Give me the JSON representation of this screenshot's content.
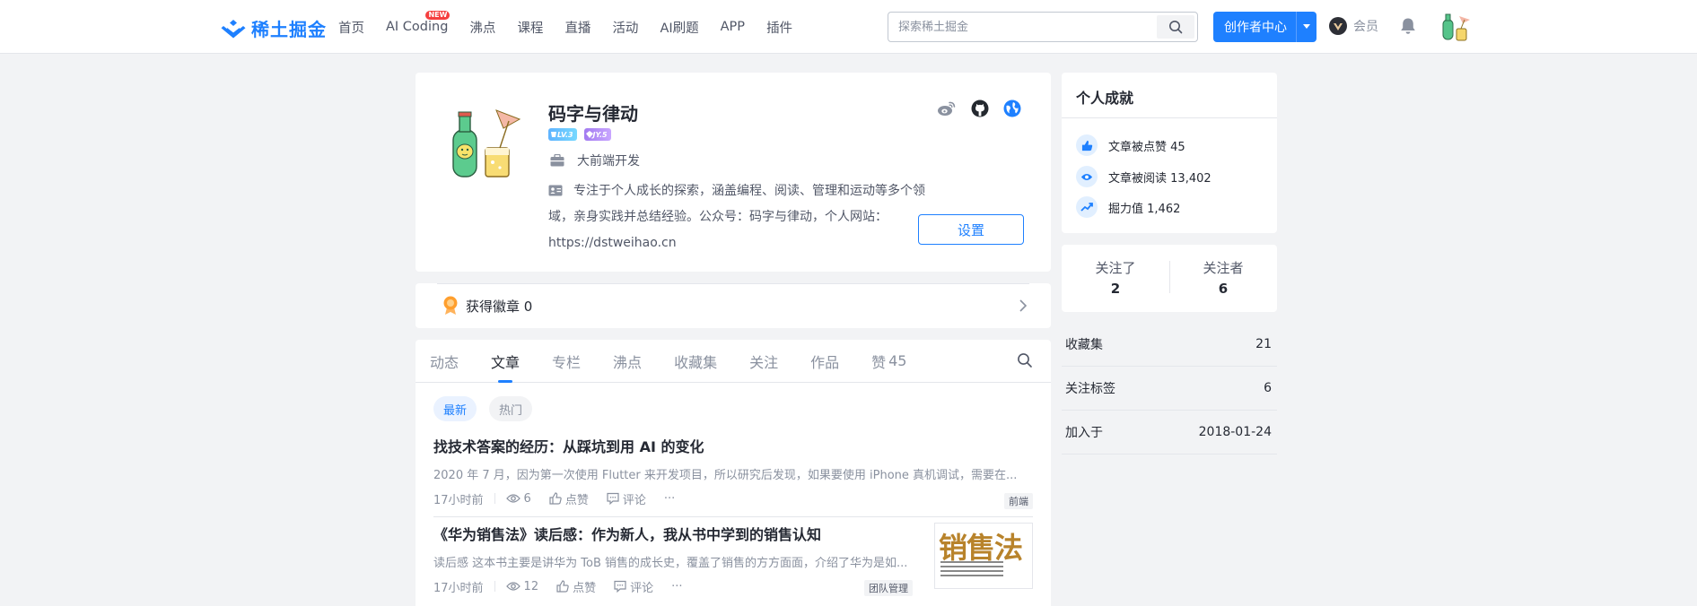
{
  "header": {
    "logo_text": "稀土掘金",
    "nav": [
      {
        "label": "首页"
      },
      {
        "label": "AI Coding",
        "badge": "NEW"
      },
      {
        "label": "沸点"
      },
      {
        "label": "课程"
      },
      {
        "label": "直播"
      },
      {
        "label": "活动"
      },
      {
        "label": "AI刷题"
      },
      {
        "label": "APP"
      },
      {
        "label": "插件"
      }
    ],
    "search_placeholder": "探索稀土掘金",
    "creator_label": "创作者中心",
    "vip_label": "会员"
  },
  "profile": {
    "username": "码字与律动",
    "level_badge": "LV.3",
    "jy_badge": "JY.5",
    "job": "大前端开发",
    "bio": "专注于个人成长的探索，涵盖编程、阅读、管理和运动等多个领域，亲身实践并总结经验。公众号：码字与律动，个人网站：https://dstweihao.cn",
    "settings_label": "设置"
  },
  "badges": {
    "label": "获得徽章 0"
  },
  "tabs": [
    {
      "label": "动态"
    },
    {
      "label": "文章",
      "active": true
    },
    {
      "label": "专栏"
    },
    {
      "label": "沸点"
    },
    {
      "label": "收藏集"
    },
    {
      "label": "关注"
    },
    {
      "label": "作品"
    },
    {
      "label": "赞",
      "count": "45"
    }
  ],
  "filters": {
    "latest": "最新",
    "hot": "热门"
  },
  "articles": [
    {
      "title": "找技术答案的经历：从踩坑到用 AI 的变化",
      "brief": "2020 年 7 月，因为第一次使用 Flutter 来开发项目，所以研究后发现，如果要使用 iPhone 真机调试，需要在...",
      "time": "17小时前",
      "views": "6",
      "like": "点赞",
      "comment": "评论",
      "more": "···",
      "tag": "前端"
    },
    {
      "title": "《华为销售法》读后感：作为新人，我从书中学到的销售认知",
      "brief": "读后感 这本书主要是讲华为 ToB 销售的成长史，覆盖了销售的方方面面，介绍了华为是如...",
      "time": "17小时前",
      "views": "12",
      "like": "点赞",
      "comment": "评论",
      "more": "···",
      "tag": "团队管理",
      "thumb_text": "销售法"
    }
  ],
  "achievements": {
    "title": "个人成就",
    "items": [
      {
        "label": "文章被点赞",
        "value": "45"
      },
      {
        "label": "文章被阅读",
        "value": "13,402"
      },
      {
        "label": "掘力值",
        "value": "1,462"
      }
    ]
  },
  "follow": {
    "following_label": "关注了",
    "following": "2",
    "followers_label": "关注者",
    "followers": "6"
  },
  "stats": [
    {
      "label": "收藏集",
      "value": "21"
    },
    {
      "label": "关注标签",
      "value": "6"
    },
    {
      "label": "加入于",
      "value": "2018-01-24"
    }
  ],
  "colors": {
    "brand": "#1e80ff",
    "text": "#252933",
    "muted": "#8a919f"
  }
}
